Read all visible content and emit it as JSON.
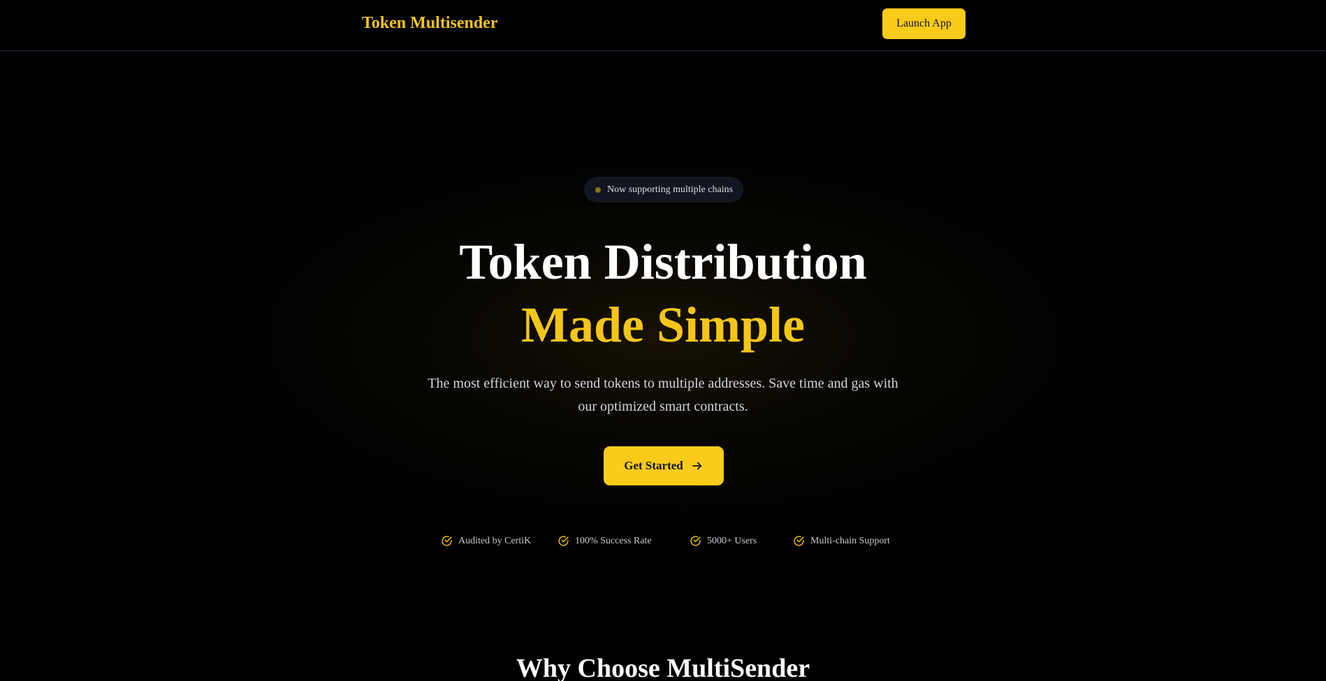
{
  "header": {
    "brand": "Token Multisender",
    "launch_label": "Launch App"
  },
  "hero": {
    "badge_text": "Now supporting multiple chains",
    "title_line1": "Token Distribution",
    "title_line2": "Made Simple",
    "subtitle": "The most efficient way to send tokens to multiple addresses. Save time and gas with our optimized smart contracts.",
    "cta_label": "Get Started",
    "cta_icon": "arrow-right-icon"
  },
  "features": [
    {
      "label": "Audited by CertiK",
      "icon": "check-circle-icon"
    },
    {
      "label": "100% Success Rate",
      "icon": "check-circle-icon"
    },
    {
      "label": "5000+ Users",
      "icon": "check-circle-icon"
    },
    {
      "label": "Multi-chain Support",
      "icon": "check-circle-icon"
    }
  ],
  "why": {
    "title": "Why Choose MultiSender"
  },
  "colors": {
    "background": "#000000",
    "accent": "#f5c518",
    "button": "#fbcb1a",
    "header_border": "#2f2d4a",
    "badge_bg": "#121620"
  }
}
